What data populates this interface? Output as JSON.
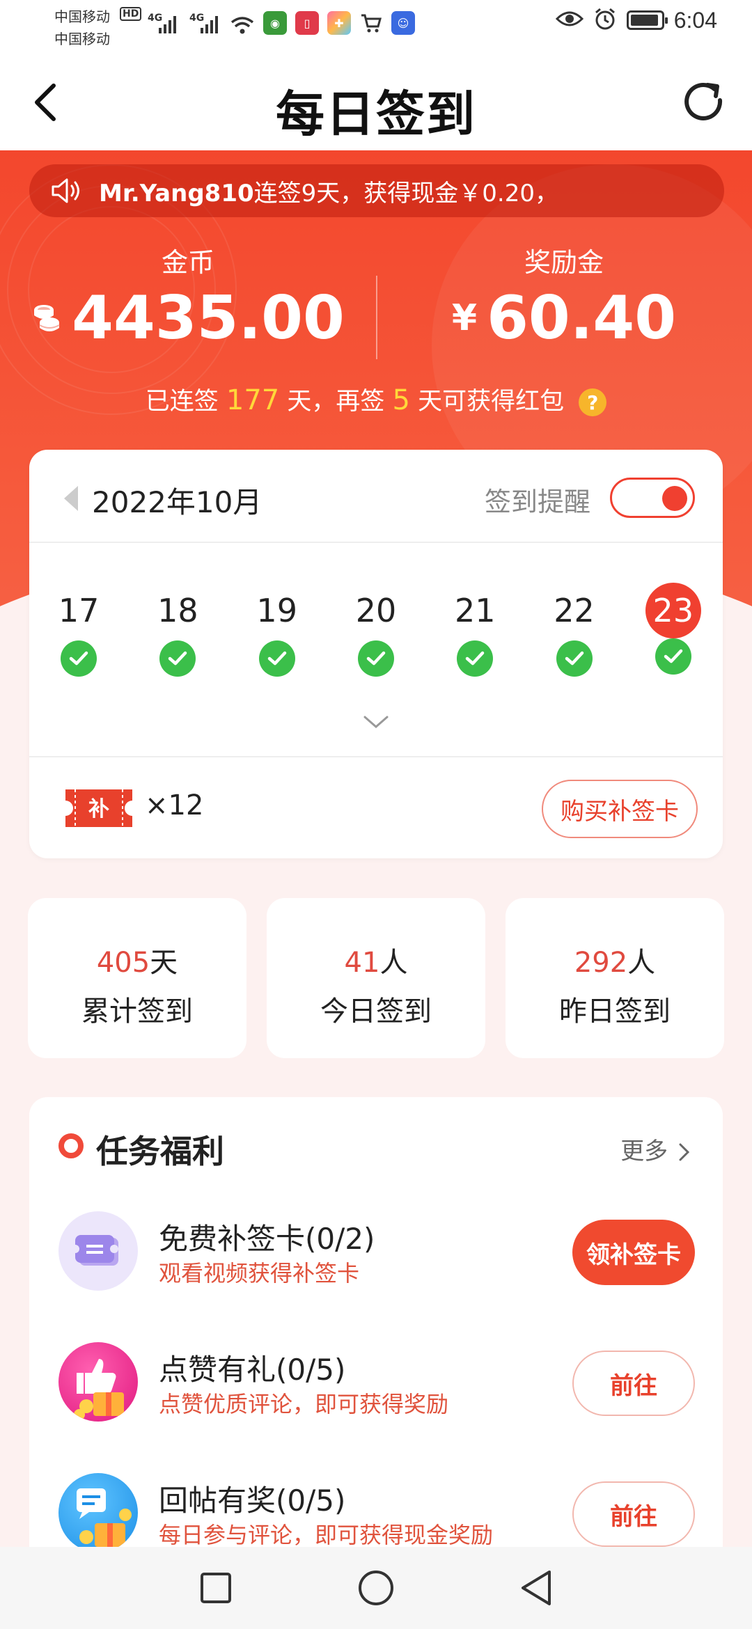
{
  "status_bar": {
    "carrier_1": "中国移动",
    "carrier_2": "中国移动",
    "hd": "HD",
    "net_1": "4G",
    "net_2": "4G",
    "time": "6:04",
    "app_icons": [
      "green-app-icon",
      "red-book-icon",
      "colorful-app-icon",
      "shopping-cart-icon",
      "blue-chat-icon"
    ]
  },
  "header": {
    "title": "每日签到"
  },
  "ticker": {
    "user": "Mr.Yang810",
    "message": "连签9天，获得现金￥0.20，"
  },
  "coins": {
    "label": "金币",
    "value": "4435.00"
  },
  "bonus": {
    "label": "奖励金",
    "currency": "¥",
    "value": "60.40"
  },
  "streak": {
    "prefix": "已连签 ",
    "days": "177",
    "middle": " 天，再签 ",
    "remaining": "5",
    "suffix": " 天可获得红包"
  },
  "calendar": {
    "month": "2022年10月",
    "reminder_label": "签到提醒",
    "reminder_on": true,
    "days": [
      {
        "num": "17",
        "checked": true,
        "today": false
      },
      {
        "num": "18",
        "checked": true,
        "today": false
      },
      {
        "num": "19",
        "checked": true,
        "today": false
      },
      {
        "num": "20",
        "checked": true,
        "today": false
      },
      {
        "num": "21",
        "checked": true,
        "today": false
      },
      {
        "num": "22",
        "checked": true,
        "today": false
      },
      {
        "num": "23",
        "checked": true,
        "today": true
      }
    ],
    "ticket_label": "补",
    "ticket_count": "×12",
    "buy_button": "购买补签卡"
  },
  "stats": [
    {
      "num": "405",
      "unit": "天",
      "label": "累计签到"
    },
    {
      "num": "41",
      "unit": "人",
      "label": "今日签到"
    },
    {
      "num": "292",
      "unit": "人",
      "label": "昨日签到"
    }
  ],
  "tasks": {
    "title": "任务福利",
    "more": "更多",
    "items": [
      {
        "title": "免费补签卡(0/2)",
        "desc": "观看视频获得补签卡",
        "button": "领补签卡",
        "style": "primary",
        "icon": "ticket-icon"
      },
      {
        "title": "点赞有礼(0/5)",
        "desc": "点赞优质评论，即可获得奖励",
        "button": "前往",
        "style": "outline",
        "icon": "thumbs-up-gift-icon"
      },
      {
        "title": "回帖有奖(0/5)",
        "desc": "每日参与评论，即可获得现金奖励",
        "button": "前往",
        "style": "outline",
        "icon": "reply-gift-icon"
      }
    ]
  },
  "colors": {
    "accent": "#f04a2f",
    "check": "#3bbf4a",
    "highlight": "#ffd83a"
  }
}
